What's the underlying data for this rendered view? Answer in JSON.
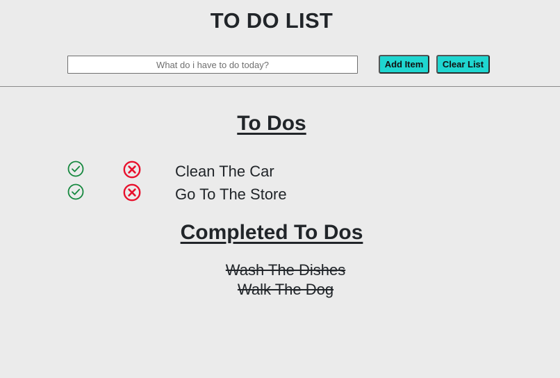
{
  "app": {
    "title": "TO DO LIST"
  },
  "input": {
    "value": "",
    "placeholder": "What do i have to do today?"
  },
  "buttons": {
    "add_label": "Add Item",
    "clear_label": "Clear List"
  },
  "todos": {
    "heading": "To Dos",
    "items": [
      {
        "label": "Clean The Car"
      },
      {
        "label": "Go To The Store"
      }
    ]
  },
  "completed": {
    "heading": "Completed To Dos",
    "items": [
      {
        "label": "Wash The Dishes"
      },
      {
        "label": "Walk The Dog"
      }
    ]
  },
  "icons": {
    "check": "check-circle-icon",
    "remove": "x-circle-icon"
  },
  "colors": {
    "background": "#ebebeb",
    "button_bg": "#1fd6d0",
    "check_green": "#15883e",
    "remove_red": "#e8102c",
    "text": "#212529"
  }
}
